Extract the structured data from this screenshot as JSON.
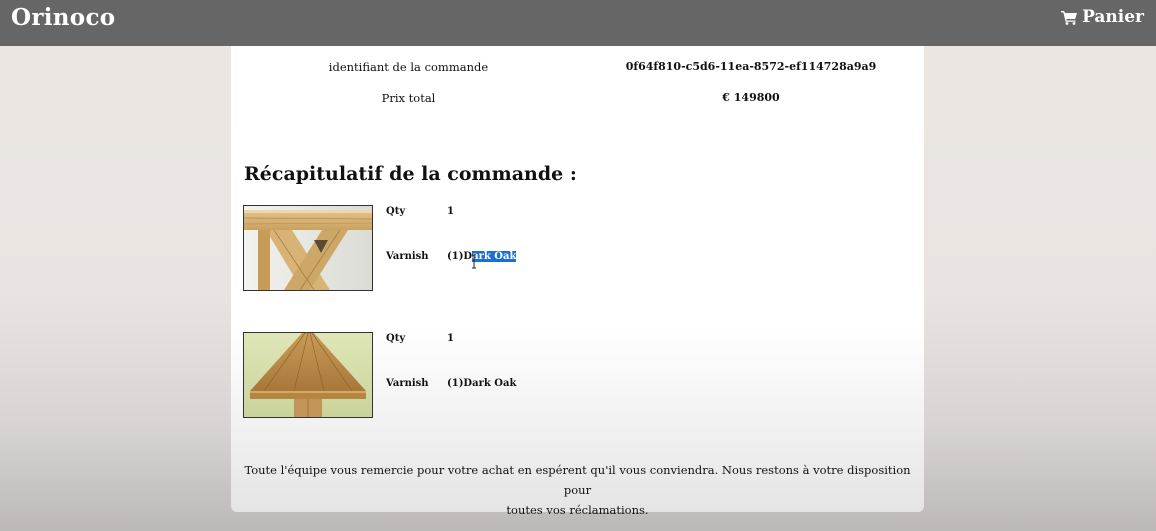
{
  "navbar": {
    "brand": "Orinoco",
    "cart_label": "Panier",
    "cart_icon": "shopping-cart-icon"
  },
  "order": {
    "id_label": "identifiant de la commande",
    "id_value": "0f64f810-c5d6-11ea-8572-ef114728a9a9",
    "total_label": "Prix total",
    "total_value": "€ 149800"
  },
  "summary": {
    "title": "Récapitulatif de la commande :",
    "items": [
      {
        "qty_label": "Qty",
        "qty_value": "1",
        "varnish_label": "Varnish",
        "varnish_prefix": "(1)D",
        "varnish_selected": "ark Oak",
        "image": "wooden-table-leg-photo"
      },
      {
        "qty_label": "Qty",
        "qty_value": "1",
        "varnish_label": "Varnish",
        "varnish_value": "(1)Dark Oak",
        "image": "wooden-table-top-photo"
      }
    ]
  },
  "footer": {
    "thanks_line1": "Toute l'équipe vous remercie pour votre achat en espérent qu'il vous conviendra. Nous restons à votre disposition pour",
    "thanks_line2": "toutes vos réclamations."
  }
}
